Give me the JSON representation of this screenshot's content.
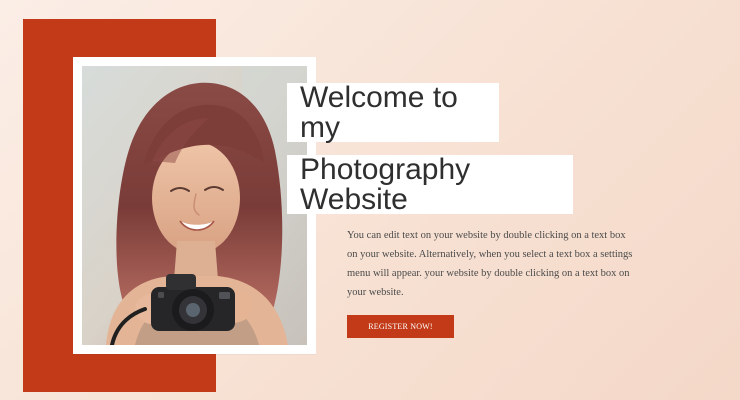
{
  "hero": {
    "title_line_1": "Welcome to my",
    "title_line_2": "Photography Website",
    "body": "You can edit text on your website by double clicking on a text box on your website. Alternatively, when you select a text box a settings menu will appear. your website by double clicking on a text box on your website.",
    "cta_label": "REGISTER NOW!"
  },
  "colors": {
    "accent": "#c23a17",
    "background": "#fbeee6",
    "title_text": "#2f2f2f",
    "body_text": "#4b4b4b"
  },
  "photo": {
    "subject": "portrait of a smiling woman holding a camera"
  }
}
